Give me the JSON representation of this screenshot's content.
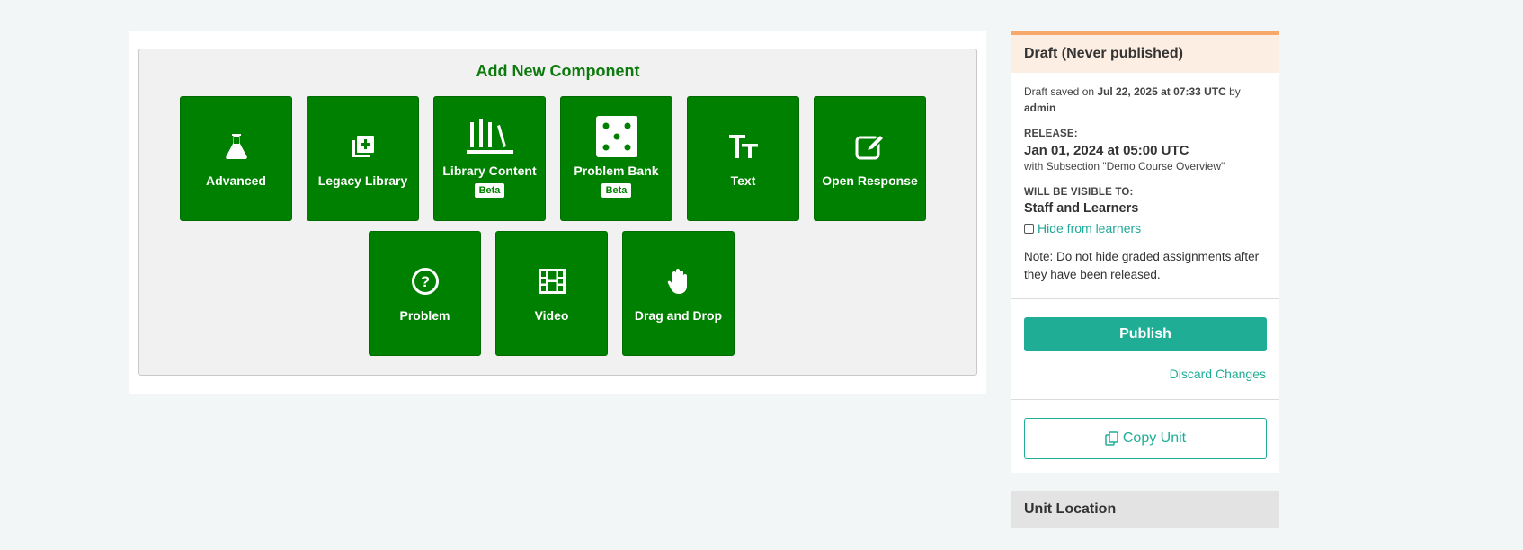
{
  "add_component": {
    "title": "Add New Component",
    "row1": [
      {
        "label": "Advanced",
        "icon": "flask-icon"
      },
      {
        "label": "Legacy Library",
        "icon": "library-add-icon"
      },
      {
        "label": "Library Content",
        "icon": "books-icon",
        "badge": "Beta"
      },
      {
        "label": "Problem Bank",
        "icon": "dice-icon",
        "badge": "Beta"
      },
      {
        "label": "Text",
        "icon": "text-size-icon"
      },
      {
        "label": "Open Response",
        "icon": "edit-icon"
      }
    ],
    "row2": [
      {
        "label": "Problem",
        "icon": "question-circle-icon"
      },
      {
        "label": "Video",
        "icon": "film-icon"
      },
      {
        "label": "Drag and Drop",
        "icon": "hand-icon"
      }
    ]
  },
  "status": {
    "header": "Draft (Never published)",
    "saved_prefix": "Draft saved on ",
    "saved_date": "Jul 22, 2025 at 07:33 UTC",
    "saved_by_prefix": " by",
    "saved_by": "admin",
    "release_label": "RELEASE:",
    "release_date": "Jan 01, 2024 at 05:00 UTC",
    "release_note": "with Subsection \"Demo Course Overview\"",
    "visible_label": "WILL BE VISIBLE TO:",
    "visible_value": "Staff and Learners",
    "hide_label": "Hide from learners",
    "note": "Note: Do not hide graded assignments after they have been released."
  },
  "actions": {
    "publish": "Publish",
    "discard": "Discard Changes",
    "copy": "Copy Unit"
  },
  "location": {
    "header": "Unit Location"
  },
  "colors": {
    "component_green": "#008000",
    "teal": "#1fad96",
    "draft_header_bg": "#fdeee3",
    "draft_border": "#f7a96b"
  }
}
